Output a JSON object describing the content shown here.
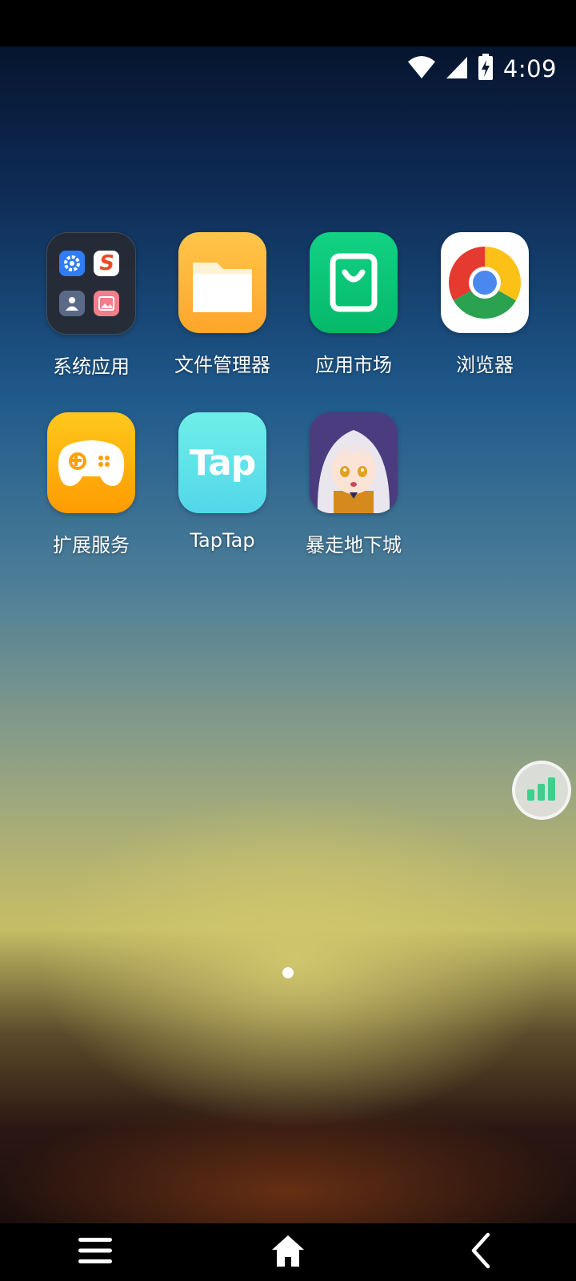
{
  "status": {
    "time": "4:09",
    "icons": [
      "wifi-icon",
      "cell-signal-icon",
      "battery-charging-icon"
    ]
  },
  "apps": [
    {
      "label": "系统应用",
      "icon": "folder-icon",
      "contents": [
        "settings-icon",
        "sohu-s-icon",
        "contacts-icon",
        "gallery-icon"
      ]
    },
    {
      "label": "文件管理器",
      "icon": "file-folder-icon"
    },
    {
      "label": "应用市场",
      "icon": "shopping-bag-icon"
    },
    {
      "label": "浏览器",
      "icon": "chrome-icon"
    },
    {
      "label": "扩展服务",
      "icon": "gamepad-icon"
    },
    {
      "label": "TapTap",
      "icon": "taptap-logo-icon",
      "logo_text": "Tap"
    },
    {
      "label": "暴走地下城",
      "icon": "anime-girl-icon"
    }
  ],
  "floating_button": {
    "icon": "bar-chart-icon",
    "color": "#3ecf8e"
  },
  "pager": {
    "current": 1,
    "total": 1
  },
  "nav": {
    "icons": [
      "menu-icon",
      "home-icon",
      "back-icon"
    ]
  }
}
